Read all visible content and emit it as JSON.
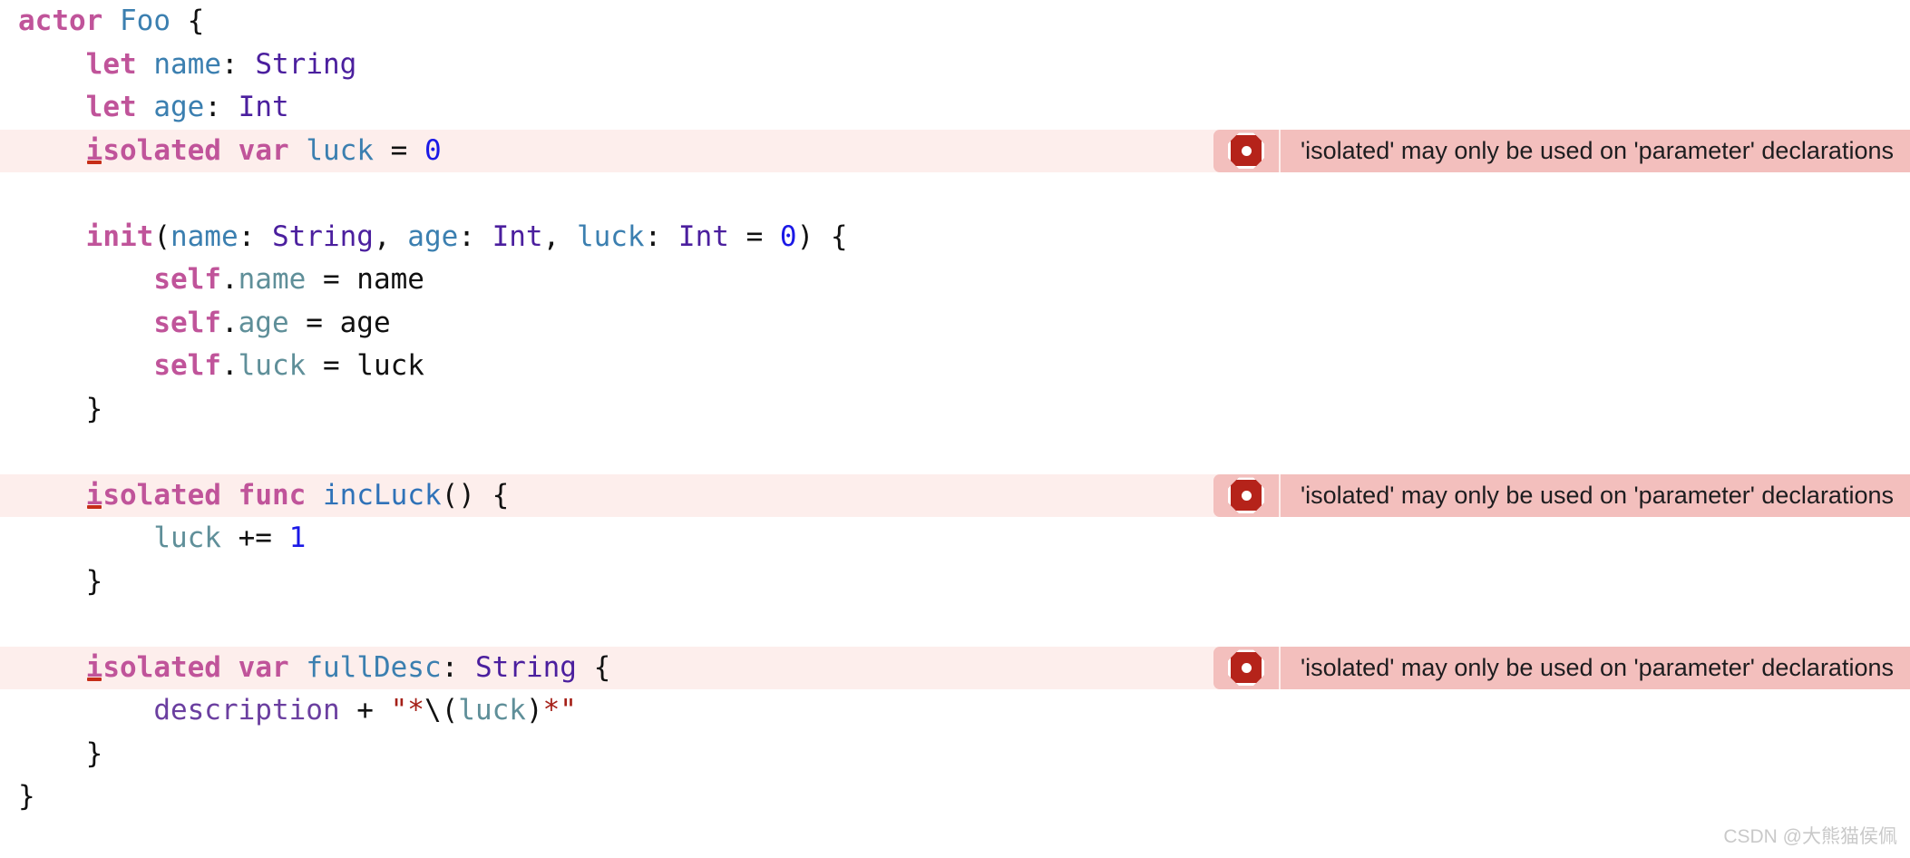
{
  "editor": {
    "background_color": "#ffffff",
    "error_line_background": "#fdeeec",
    "diagnostic_background": "#f3bfbd",
    "diagnostic_icon_color": "#b5231a",
    "squiggle_color": "#c62d18"
  },
  "diagnostic_message": "'isolated' may only be used on 'parameter' declarations",
  "diagnostic_icon": "error-octagon-icon",
  "watermark": "CSDN @大熊猫侯佩",
  "code": {
    "language": "swift",
    "full_text": "actor Foo {\n    let name: String\n    let age: Int\n    isolated var luck = 0\n\n    init(name: String, age: Int, luck: Int = 0) {\n        self.name = name\n        self.age = age\n        self.luck = luck\n    }\n\n    isolated func incLuck() {\n        luck += 1\n    }\n\n    isolated var fullDesc: String {\n        description + \"*\\(luck)*\"\n    }\n}",
    "lines": [
      {
        "n": 1,
        "error": false,
        "tokens": [
          {
            "t": "actor",
            "c": "kw"
          },
          {
            "t": " ",
            "c": "plain"
          },
          {
            "t": "Foo",
            "c": "prop"
          },
          {
            "t": " {",
            "c": "plain"
          }
        ]
      },
      {
        "n": 2,
        "error": false,
        "tokens": [
          {
            "t": "    ",
            "c": "plain"
          },
          {
            "t": "let",
            "c": "kw"
          },
          {
            "t": " ",
            "c": "plain"
          },
          {
            "t": "name",
            "c": "prop"
          },
          {
            "t": ":",
            "c": "plain"
          },
          {
            "t": " ",
            "c": "plain"
          },
          {
            "t": "String",
            "c": "type"
          }
        ]
      },
      {
        "n": 3,
        "error": false,
        "tokens": [
          {
            "t": "    ",
            "c": "plain"
          },
          {
            "t": "let",
            "c": "kw"
          },
          {
            "t": " ",
            "c": "plain"
          },
          {
            "t": "age",
            "c": "prop"
          },
          {
            "t": ":",
            "c": "plain"
          },
          {
            "t": " ",
            "c": "plain"
          },
          {
            "t": "Int",
            "c": "type"
          }
        ]
      },
      {
        "n": 4,
        "error": true,
        "tokens": [
          {
            "t": "    ",
            "c": "plain"
          },
          {
            "t": "i",
            "c": "kw",
            "squiggle": true
          },
          {
            "t": "solated",
            "c": "kw"
          },
          {
            "t": " ",
            "c": "plain"
          },
          {
            "t": "var",
            "c": "kw"
          },
          {
            "t": " ",
            "c": "plain"
          },
          {
            "t": "luck",
            "c": "prop"
          },
          {
            "t": " ",
            "c": "plain"
          },
          {
            "t": "=",
            "c": "plain"
          },
          {
            "t": " ",
            "c": "plain"
          },
          {
            "t": "0",
            "c": "num"
          }
        ]
      },
      {
        "n": 5,
        "error": false,
        "tokens": []
      },
      {
        "n": 6,
        "error": false,
        "tokens": [
          {
            "t": "    ",
            "c": "plain"
          },
          {
            "t": "init",
            "c": "kw"
          },
          {
            "t": "(",
            "c": "plain"
          },
          {
            "t": "name",
            "c": "prop"
          },
          {
            "t": ": ",
            "c": "plain"
          },
          {
            "t": "String",
            "c": "type"
          },
          {
            "t": ", ",
            "c": "plain"
          },
          {
            "t": "age",
            "c": "prop"
          },
          {
            "t": ": ",
            "c": "plain"
          },
          {
            "t": "Int",
            "c": "type"
          },
          {
            "t": ", ",
            "c": "plain"
          },
          {
            "t": "luck",
            "c": "prop"
          },
          {
            "t": ": ",
            "c": "plain"
          },
          {
            "t": "Int",
            "c": "type"
          },
          {
            "t": " = ",
            "c": "plain"
          },
          {
            "t": "0",
            "c": "num"
          },
          {
            "t": ") {",
            "c": "plain"
          }
        ]
      },
      {
        "n": 7,
        "error": false,
        "tokens": [
          {
            "t": "        ",
            "c": "plain"
          },
          {
            "t": "self",
            "c": "kw"
          },
          {
            "t": ".",
            "c": "plain"
          },
          {
            "t": "name",
            "c": "member"
          },
          {
            "t": " = ",
            "c": "plain"
          },
          {
            "t": "name",
            "c": "plain"
          }
        ]
      },
      {
        "n": 8,
        "error": false,
        "tokens": [
          {
            "t": "        ",
            "c": "plain"
          },
          {
            "t": "self",
            "c": "kw"
          },
          {
            "t": ".",
            "c": "plain"
          },
          {
            "t": "age",
            "c": "member"
          },
          {
            "t": " = ",
            "c": "plain"
          },
          {
            "t": "age",
            "c": "plain"
          }
        ]
      },
      {
        "n": 9,
        "error": false,
        "tokens": [
          {
            "t": "        ",
            "c": "plain"
          },
          {
            "t": "self",
            "c": "kw"
          },
          {
            "t": ".",
            "c": "plain"
          },
          {
            "t": "luck",
            "c": "member"
          },
          {
            "t": " = ",
            "c": "plain"
          },
          {
            "t": "luck",
            "c": "plain"
          }
        ]
      },
      {
        "n": 10,
        "error": false,
        "tokens": [
          {
            "t": "    }",
            "c": "plain"
          }
        ]
      },
      {
        "n": 11,
        "error": false,
        "tokens": []
      },
      {
        "n": 12,
        "error": true,
        "tokens": [
          {
            "t": "    ",
            "c": "plain"
          },
          {
            "t": "i",
            "c": "kw",
            "squiggle": true
          },
          {
            "t": "solated",
            "c": "kw"
          },
          {
            "t": " ",
            "c": "plain"
          },
          {
            "t": "func",
            "c": "kw"
          },
          {
            "t": " ",
            "c": "plain"
          },
          {
            "t": "incLuck",
            "c": "func-name"
          },
          {
            "t": "() {",
            "c": "plain"
          }
        ]
      },
      {
        "n": 13,
        "error": false,
        "tokens": [
          {
            "t": "        ",
            "c": "plain"
          },
          {
            "t": "luck",
            "c": "member"
          },
          {
            "t": " += ",
            "c": "plain"
          },
          {
            "t": "1",
            "c": "num"
          }
        ]
      },
      {
        "n": 14,
        "error": false,
        "tokens": [
          {
            "t": "    }",
            "c": "plain"
          }
        ]
      },
      {
        "n": 15,
        "error": false,
        "tokens": []
      },
      {
        "n": 16,
        "error": true,
        "tokens": [
          {
            "t": "    ",
            "c": "plain"
          },
          {
            "t": "i",
            "c": "kw",
            "squiggle": true
          },
          {
            "t": "solated",
            "c": "kw"
          },
          {
            "t": " ",
            "c": "plain"
          },
          {
            "t": "var",
            "c": "kw"
          },
          {
            "t": " ",
            "c": "plain"
          },
          {
            "t": "fullDesc",
            "c": "prop"
          },
          {
            "t": ": ",
            "c": "plain"
          },
          {
            "t": "String",
            "c": "type"
          },
          {
            "t": " {",
            "c": "plain"
          }
        ]
      },
      {
        "n": 17,
        "error": false,
        "tokens": [
          {
            "t": "        ",
            "c": "plain"
          },
          {
            "t": "description",
            "c": "ident-pur"
          },
          {
            "t": " + ",
            "c": "plain"
          },
          {
            "t": "\"*",
            "c": "strlit"
          },
          {
            "t": "\\(",
            "c": "plain"
          },
          {
            "t": "luck",
            "c": "member"
          },
          {
            "t": ")",
            "c": "plain"
          },
          {
            "t": "*\"",
            "c": "strlit"
          }
        ]
      },
      {
        "n": 18,
        "error": false,
        "tokens": [
          {
            "t": "    }",
            "c": "plain"
          }
        ]
      },
      {
        "n": 19,
        "error": false,
        "tokens": [
          {
            "t": "}",
            "c": "plain"
          }
        ]
      }
    ]
  }
}
